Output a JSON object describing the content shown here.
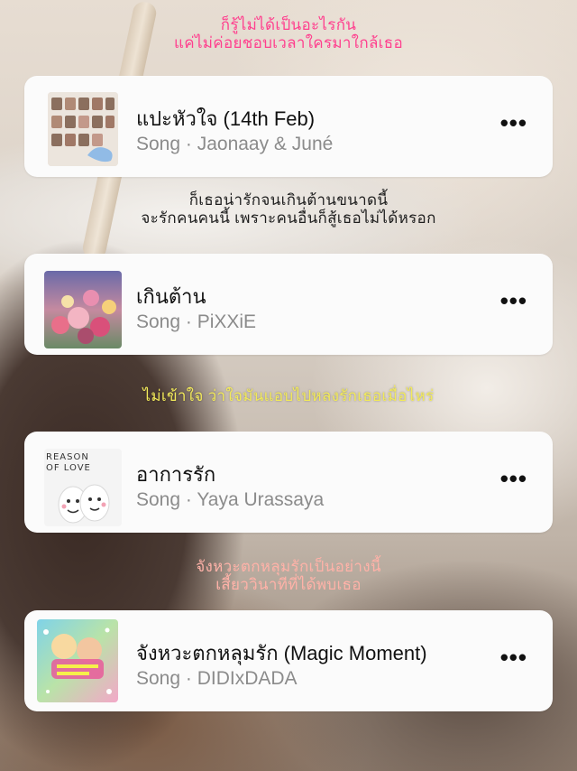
{
  "lyrics": [
    {
      "lines": [
        "ก็รู้ไม่ได้เป็นอะไรกัน",
        "แค่ไม่ค่อยชอบเวลาใครมาใกล้เธอ"
      ],
      "color": "#ff3f8e"
    },
    {
      "lines": [
        "ก็เธอน่ารักจนเกินต้านขนาดนี้",
        "จะรักคนคนนี้ เพราะคนอื่นก็สู้เธอไม่ได้หรอก"
      ],
      "color": "#1e1e1e"
    },
    {
      "lines": [
        "ไม่เข้าใจ ว่าใจมันแอบไปหลงรักเธอเมื่อไหร่"
      ],
      "color": "#f2ea5a"
    },
    {
      "lines": [
        "จังหวะตกหลุมรักเป็นอย่างนี้",
        "เสี้ยววินาทีที่ได้พบเธอ"
      ],
      "color": "#ffb2a8"
    }
  ],
  "songs": [
    {
      "title": "แปะหัวใจ (14th Feb)",
      "subtitle": "Song · Jaonaay & Juné",
      "art_icon": "group-photo-album-art",
      "more": "•••"
    },
    {
      "title": "เกินต้าน",
      "subtitle": "Song · PiXXiE",
      "art_icon": "floral-album-art",
      "more": "•••"
    },
    {
      "title": "อาการรัก",
      "subtitle": "Song · Yaya Urassaya",
      "art_text": "REASON OF LOVE",
      "art_icon": "eggs-album-art",
      "more": "•••"
    },
    {
      "title": "จังหวะตกหลุมรัก (Magic Moment)",
      "subtitle": "Song · DIDIxDADA",
      "art_icon": "sparkle-album-art",
      "more": "•••"
    }
  ]
}
